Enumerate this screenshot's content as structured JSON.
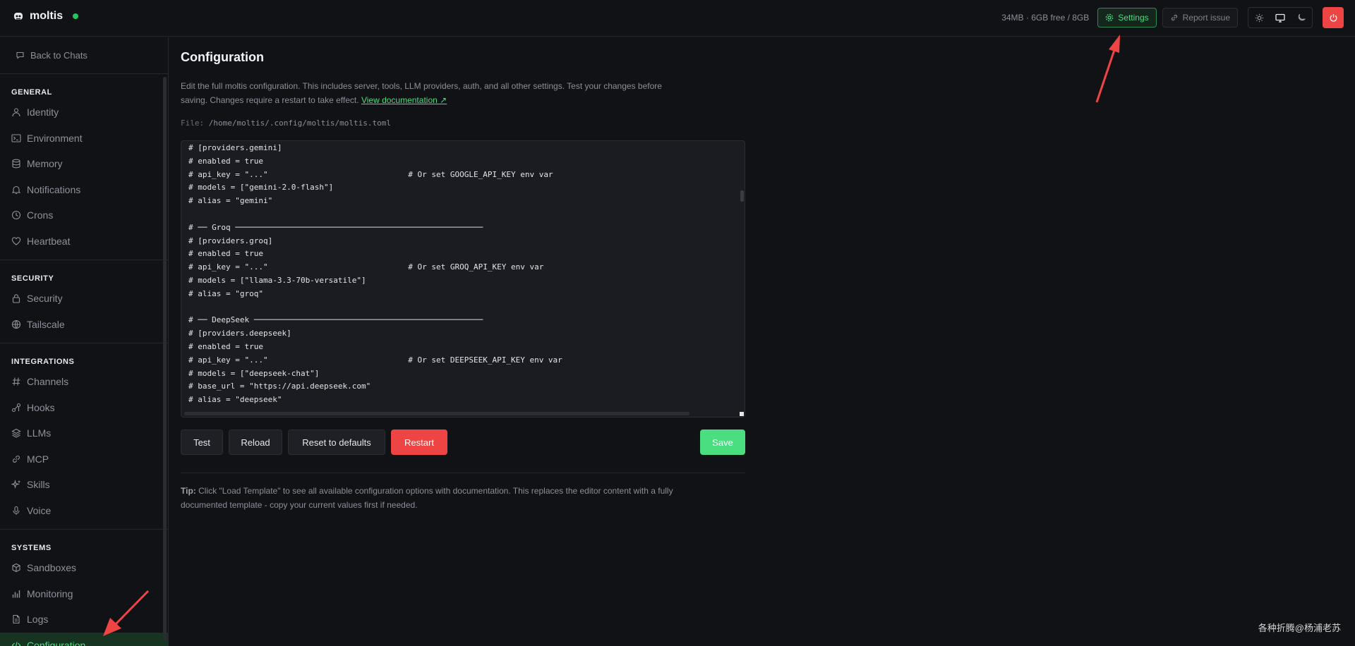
{
  "app": {
    "name": "moltis",
    "online": true
  },
  "header": {
    "memory": "34MB · 6GB free / 8GB",
    "settings_label": "Settings",
    "report_label": "Report issue"
  },
  "sidebar": {
    "back_label": "Back to Chats",
    "sections": [
      {
        "title": "GENERAL",
        "items": [
          {
            "label": "Identity",
            "icon": "user-icon"
          },
          {
            "label": "Environment",
            "icon": "terminal-icon"
          },
          {
            "label": "Memory",
            "icon": "database-icon"
          },
          {
            "label": "Notifications",
            "icon": "bell-icon"
          },
          {
            "label": "Crons",
            "icon": "clock-icon"
          },
          {
            "label": "Heartbeat",
            "icon": "heart-icon"
          }
        ]
      },
      {
        "title": "SECURITY",
        "items": [
          {
            "label": "Security",
            "icon": "lock-icon"
          },
          {
            "label": "Tailscale",
            "icon": "network-icon"
          }
        ]
      },
      {
        "title": "INTEGRATIONS",
        "items": [
          {
            "label": "Channels",
            "icon": "hash-icon"
          },
          {
            "label": "Hooks",
            "icon": "hook-icon"
          },
          {
            "label": "LLMs",
            "icon": "layers-icon"
          },
          {
            "label": "MCP",
            "icon": "link-icon"
          },
          {
            "label": "Skills",
            "icon": "sparkles-icon"
          },
          {
            "label": "Voice",
            "icon": "mic-icon"
          }
        ]
      },
      {
        "title": "SYSTEMS",
        "items": [
          {
            "label": "Sandboxes",
            "icon": "box-icon"
          },
          {
            "label": "Monitoring",
            "icon": "bar-chart-icon"
          },
          {
            "label": "Logs",
            "icon": "file-icon"
          },
          {
            "label": "Configuration",
            "icon": "code-icon",
            "active": true
          }
        ]
      }
    ]
  },
  "main": {
    "title": "Configuration",
    "description": "Edit the full moltis configuration. This includes server, tools, LLM providers, auth, and all other settings. Test your changes before saving. Changes require a restart to take effect.",
    "doc_link": "View documentation ↗",
    "file_label": "File:",
    "file_path": "/home/moltis/.config/moltis/moltis.toml",
    "code_lines": [
      "# [providers.gemini]",
      "# enabled = true",
      "# api_key = \"...\"                              # Or set GOOGLE_API_KEY env var",
      "# models = [\"gemini-2.0-flash\"]",
      "# alias = \"gemini\"",
      "",
      "# ── Groq ─────────────────────────────────────────────────────",
      "# [providers.groq]",
      "# enabled = true",
      "# api_key = \"...\"                              # Or set GROQ_API_KEY env var",
      "# models = [\"llama-3.3-70b-versatile\"]",
      "# alias = \"groq\"",
      "",
      "# ── DeepSeek ─────────────────────────────────────────────────",
      "# [providers.deepseek]",
      "# enabled = true",
      "# api_key = \"...\"                              # Or set DEEPSEEK_API_KEY env var",
      "# models = [\"deepseek-chat\"]",
      "# base_url = \"https://api.deepseek.com\"",
      "# alias = \"deepseek\""
    ],
    "buttons": {
      "test": "Test",
      "reload": "Reload",
      "reset": "Reset to defaults",
      "restart": "Restart",
      "save": "Save"
    },
    "tip_label": "Tip:",
    "tip_text": "Click \"Load Template\" to see all available configuration options with documentation. This replaces the editor content with a fully documented template - copy your current values first if needed."
  },
  "watermark": "各种折腾@杨浦老苏",
  "colors": {
    "accent": "#4ade80",
    "danger": "#ef4444",
    "background": "#111216"
  }
}
